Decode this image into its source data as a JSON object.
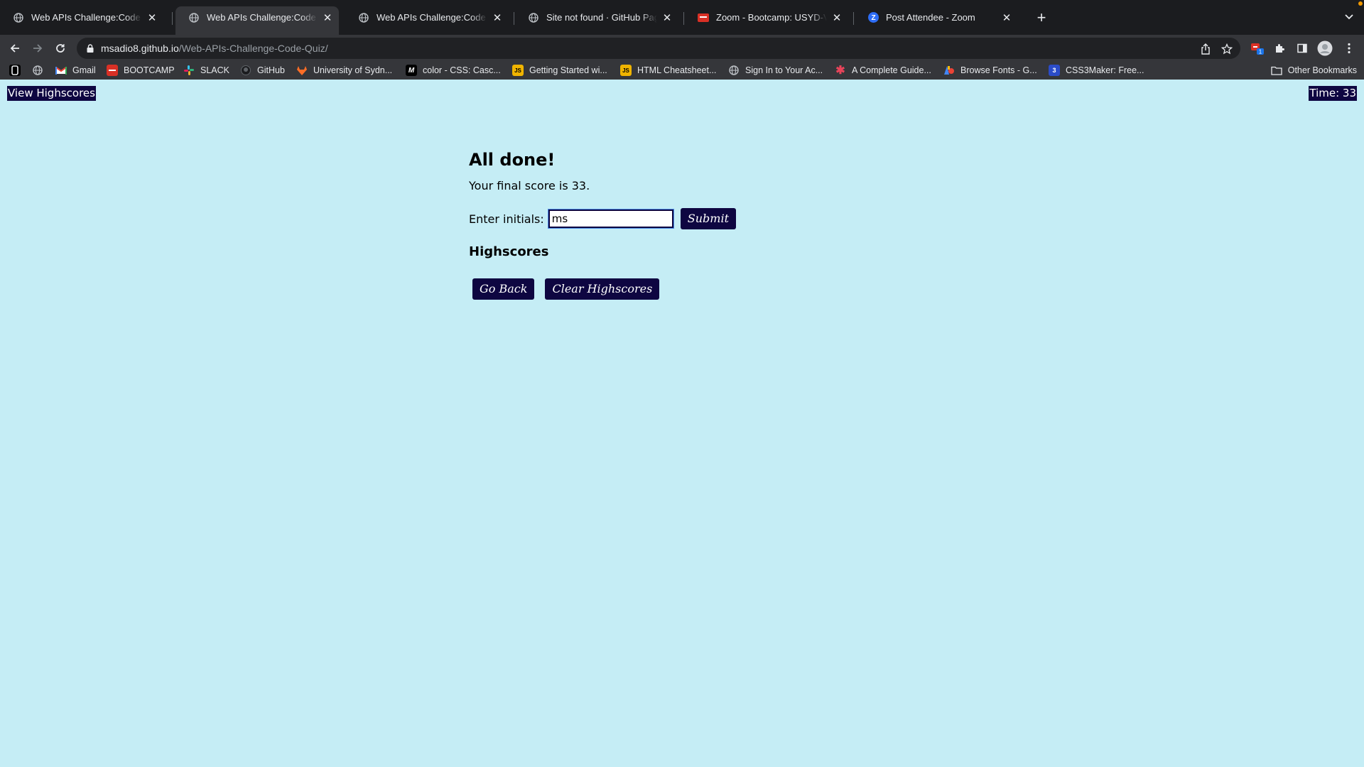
{
  "browser": {
    "tabs": [
      {
        "title": "Web APIs Challenge:Code Quiz",
        "icon": "globe-icon",
        "active": false
      },
      {
        "title": "Web APIs Challenge:Code Quiz",
        "icon": "globe-icon",
        "active": true
      },
      {
        "title": "Web APIs Challenge:Code Quiz",
        "icon": "globe-icon",
        "active": false
      },
      {
        "title": "Site not found · GitHub Pages",
        "icon": "globe-icon",
        "active": false
      },
      {
        "title": "Zoom - Bootcamp: USYD-VIRT",
        "icon": "zoom-bootcamp-icon",
        "active": false
      },
      {
        "title": "Post Attendee - Zoom",
        "icon": "zoom-icon",
        "active": false
      }
    ],
    "address": {
      "host": "msadio8.github.io",
      "path": "/Web-APIs-Challenge-Code-Quiz/"
    },
    "bookmarks": [
      {
        "label": "",
        "icon": "app-icon"
      },
      {
        "label": "",
        "icon": "globe-icon"
      },
      {
        "label": "Gmail",
        "icon": "gmail-icon"
      },
      {
        "label": "BOOTCAMP",
        "icon": "bootcamp-icon"
      },
      {
        "label": "SLACK",
        "icon": "slack-icon"
      },
      {
        "label": "GitHub",
        "icon": "github-icon"
      },
      {
        "label": "University of Sydn...",
        "icon": "gitlab-icon"
      },
      {
        "label": "color - CSS: Casc...",
        "icon": "mdn-icon"
      },
      {
        "label": "Getting Started wi...",
        "icon": "js-icon"
      },
      {
        "label": "HTML Cheatsheet...",
        "icon": "js-icon"
      },
      {
        "label": "Sign In to Your Ac...",
        "icon": "globe-icon"
      },
      {
        "label": "A Complete Guide...",
        "icon": "asterisk-icon"
      },
      {
        "label": "Browse Fonts - G...",
        "icon": "google-fonts-icon"
      },
      {
        "label": "CSS3Maker: Free...",
        "icon": "css3maker-icon"
      }
    ],
    "other_bookmarks": "Other Bookmarks"
  },
  "header": {
    "view_highscores": "View Highscores",
    "timer": "Time: 33"
  },
  "quiz": {
    "heading": "All done!",
    "final_score": "Your final score is 33.",
    "initials_label": "Enter initials:",
    "initials_value": "ms",
    "submit_label": "Submit",
    "highscores_heading": "Highscores",
    "go_back_label": "Go Back",
    "clear_label": "Clear Highscores"
  },
  "colors": {
    "page_background": "#c5edf5",
    "accent": "#0e0641"
  }
}
